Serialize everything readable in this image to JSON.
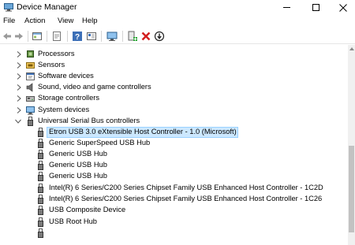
{
  "window": {
    "title": "Device Manager"
  },
  "menu": [
    "File",
    "Action",
    "View",
    "Help"
  ],
  "toolbar": {
    "icons": [
      "back-arrow-icon",
      "forward-arrow-icon",
      "properties-view-icon",
      "show-hidden-icon",
      "help-icon",
      "resources-view-icon",
      "scan-hardware-icon",
      "update-driver-icon",
      "uninstall-device-icon",
      "disable-device-icon"
    ]
  },
  "tree": {
    "categories": [
      {
        "label": "Processors",
        "icon": "processor-icon",
        "expanded": false
      },
      {
        "label": "Sensors",
        "icon": "sensor-icon",
        "expanded": false
      },
      {
        "label": "Software devices",
        "icon": "software-device-icon",
        "expanded": false
      },
      {
        "label": "Sound, video and game controllers",
        "icon": "speaker-icon",
        "expanded": false
      },
      {
        "label": "Storage controllers",
        "icon": "storage-controller-icon",
        "expanded": false
      },
      {
        "label": "System devices",
        "icon": "system-device-icon",
        "expanded": false
      },
      {
        "label": "Universal Serial Bus controllers",
        "icon": "usb-icon",
        "expanded": true
      }
    ],
    "usb_children": [
      {
        "label": "Etron USB 3.0 eXtensible Host Controller - 1.0 (Microsoft)",
        "selected": true
      },
      {
        "label": "Generic SuperSpeed USB Hub",
        "selected": false
      },
      {
        "label": "Generic USB Hub",
        "selected": false
      },
      {
        "label": "Generic USB Hub",
        "selected": false
      },
      {
        "label": "Generic USB Hub",
        "selected": false
      },
      {
        "label": "Intel(R) 6 Series/C200 Series Chipset Family USB Enhanced Host Controller - 1C2D",
        "selected": false
      },
      {
        "label": "Intel(R) 6 Series/C200 Series Chipset Family USB Enhanced Host Controller - 1C26",
        "selected": false
      },
      {
        "label": "USB Composite Device",
        "selected": false
      },
      {
        "label": "USB Root Hub",
        "selected": false
      }
    ]
  },
  "colors": {
    "selection_bg": "#cce8ff",
    "selection_border": "#99d1ff"
  }
}
